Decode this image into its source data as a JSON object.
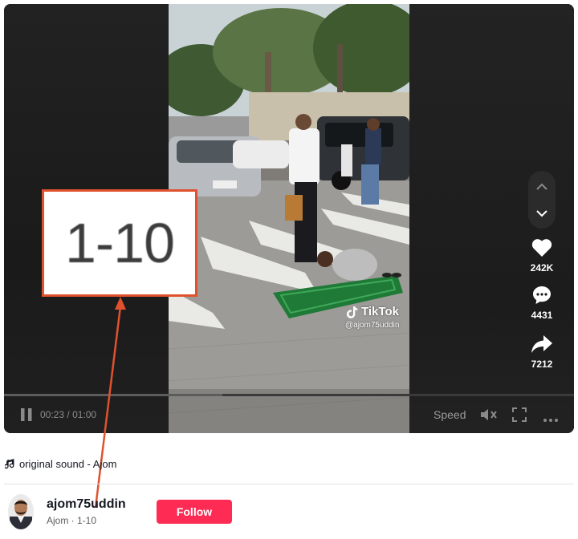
{
  "player": {
    "current_time": "00:23",
    "duration": "01:00",
    "time_separator": "/",
    "progress": 0.383,
    "speed_label": "Speed",
    "watermark_brand": "TikTok",
    "watermark_handle": "@ajom75uddin"
  },
  "actions": {
    "likes": "242K",
    "comments": "4431",
    "shares": "7212"
  },
  "overlay": {
    "zoom_text": "1-10"
  },
  "sound": {
    "label": "original sound - Ajom"
  },
  "author": {
    "username": "ajom75uddin",
    "subline": "Ajom · 1-10",
    "follow_label": "Follow"
  },
  "colors": {
    "accent": "#fe2c55",
    "highlight": "#e0522e"
  },
  "icons": [
    "chevron-up-icon",
    "chevron-down-icon",
    "heart-icon",
    "comment-icon",
    "share-icon",
    "pause-icon",
    "mute-icon",
    "fullscreen-icon",
    "more-icon",
    "music-note-icon",
    "tiktok-logo-icon"
  ]
}
